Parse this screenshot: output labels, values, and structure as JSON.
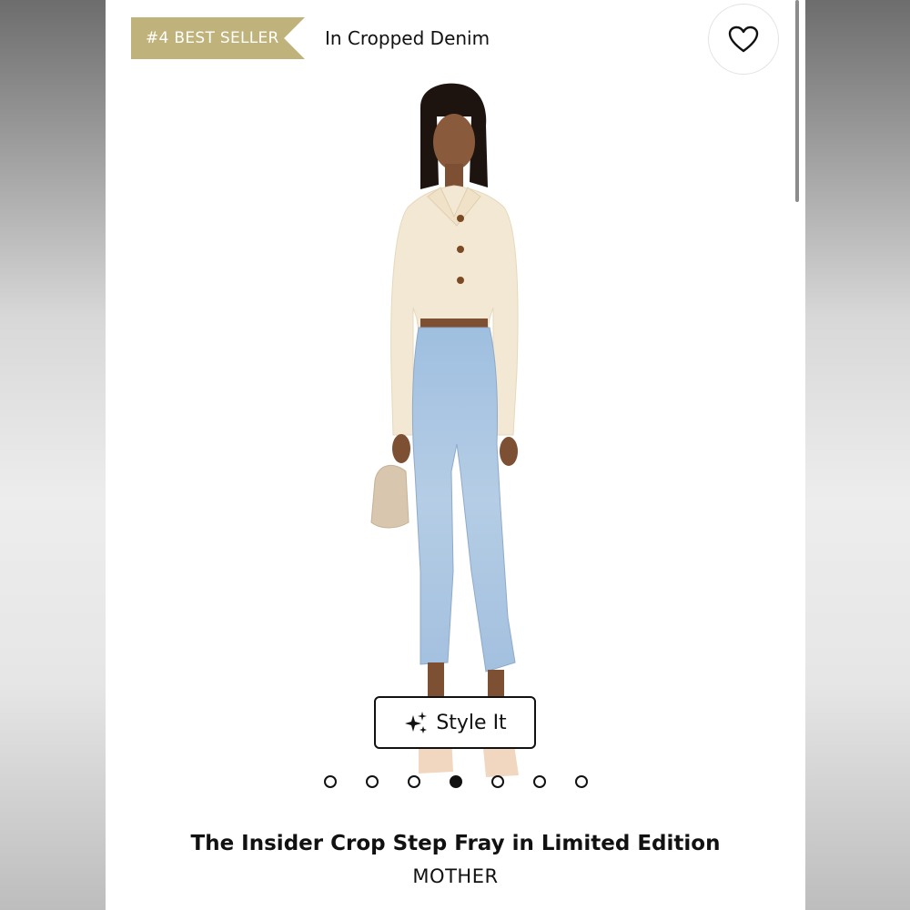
{
  "badge": {
    "label": "#4 BEST SELLER"
  },
  "category": {
    "label": "In Cropped Denim"
  },
  "favorite": {
    "icon": "heart-icon"
  },
  "style_button": {
    "label": "Style It",
    "icon": "sparkles-icon"
  },
  "carousel": {
    "total": 7,
    "active_index": 3
  },
  "product": {
    "title": "The Insider Crop Step Fray in Limited Edition",
    "brand": "MOTHER"
  },
  "colors": {
    "badge": "#bfb27a",
    "sweater": "#f3e8d3",
    "denim": "#a9c4df",
    "accent": "#111111"
  }
}
